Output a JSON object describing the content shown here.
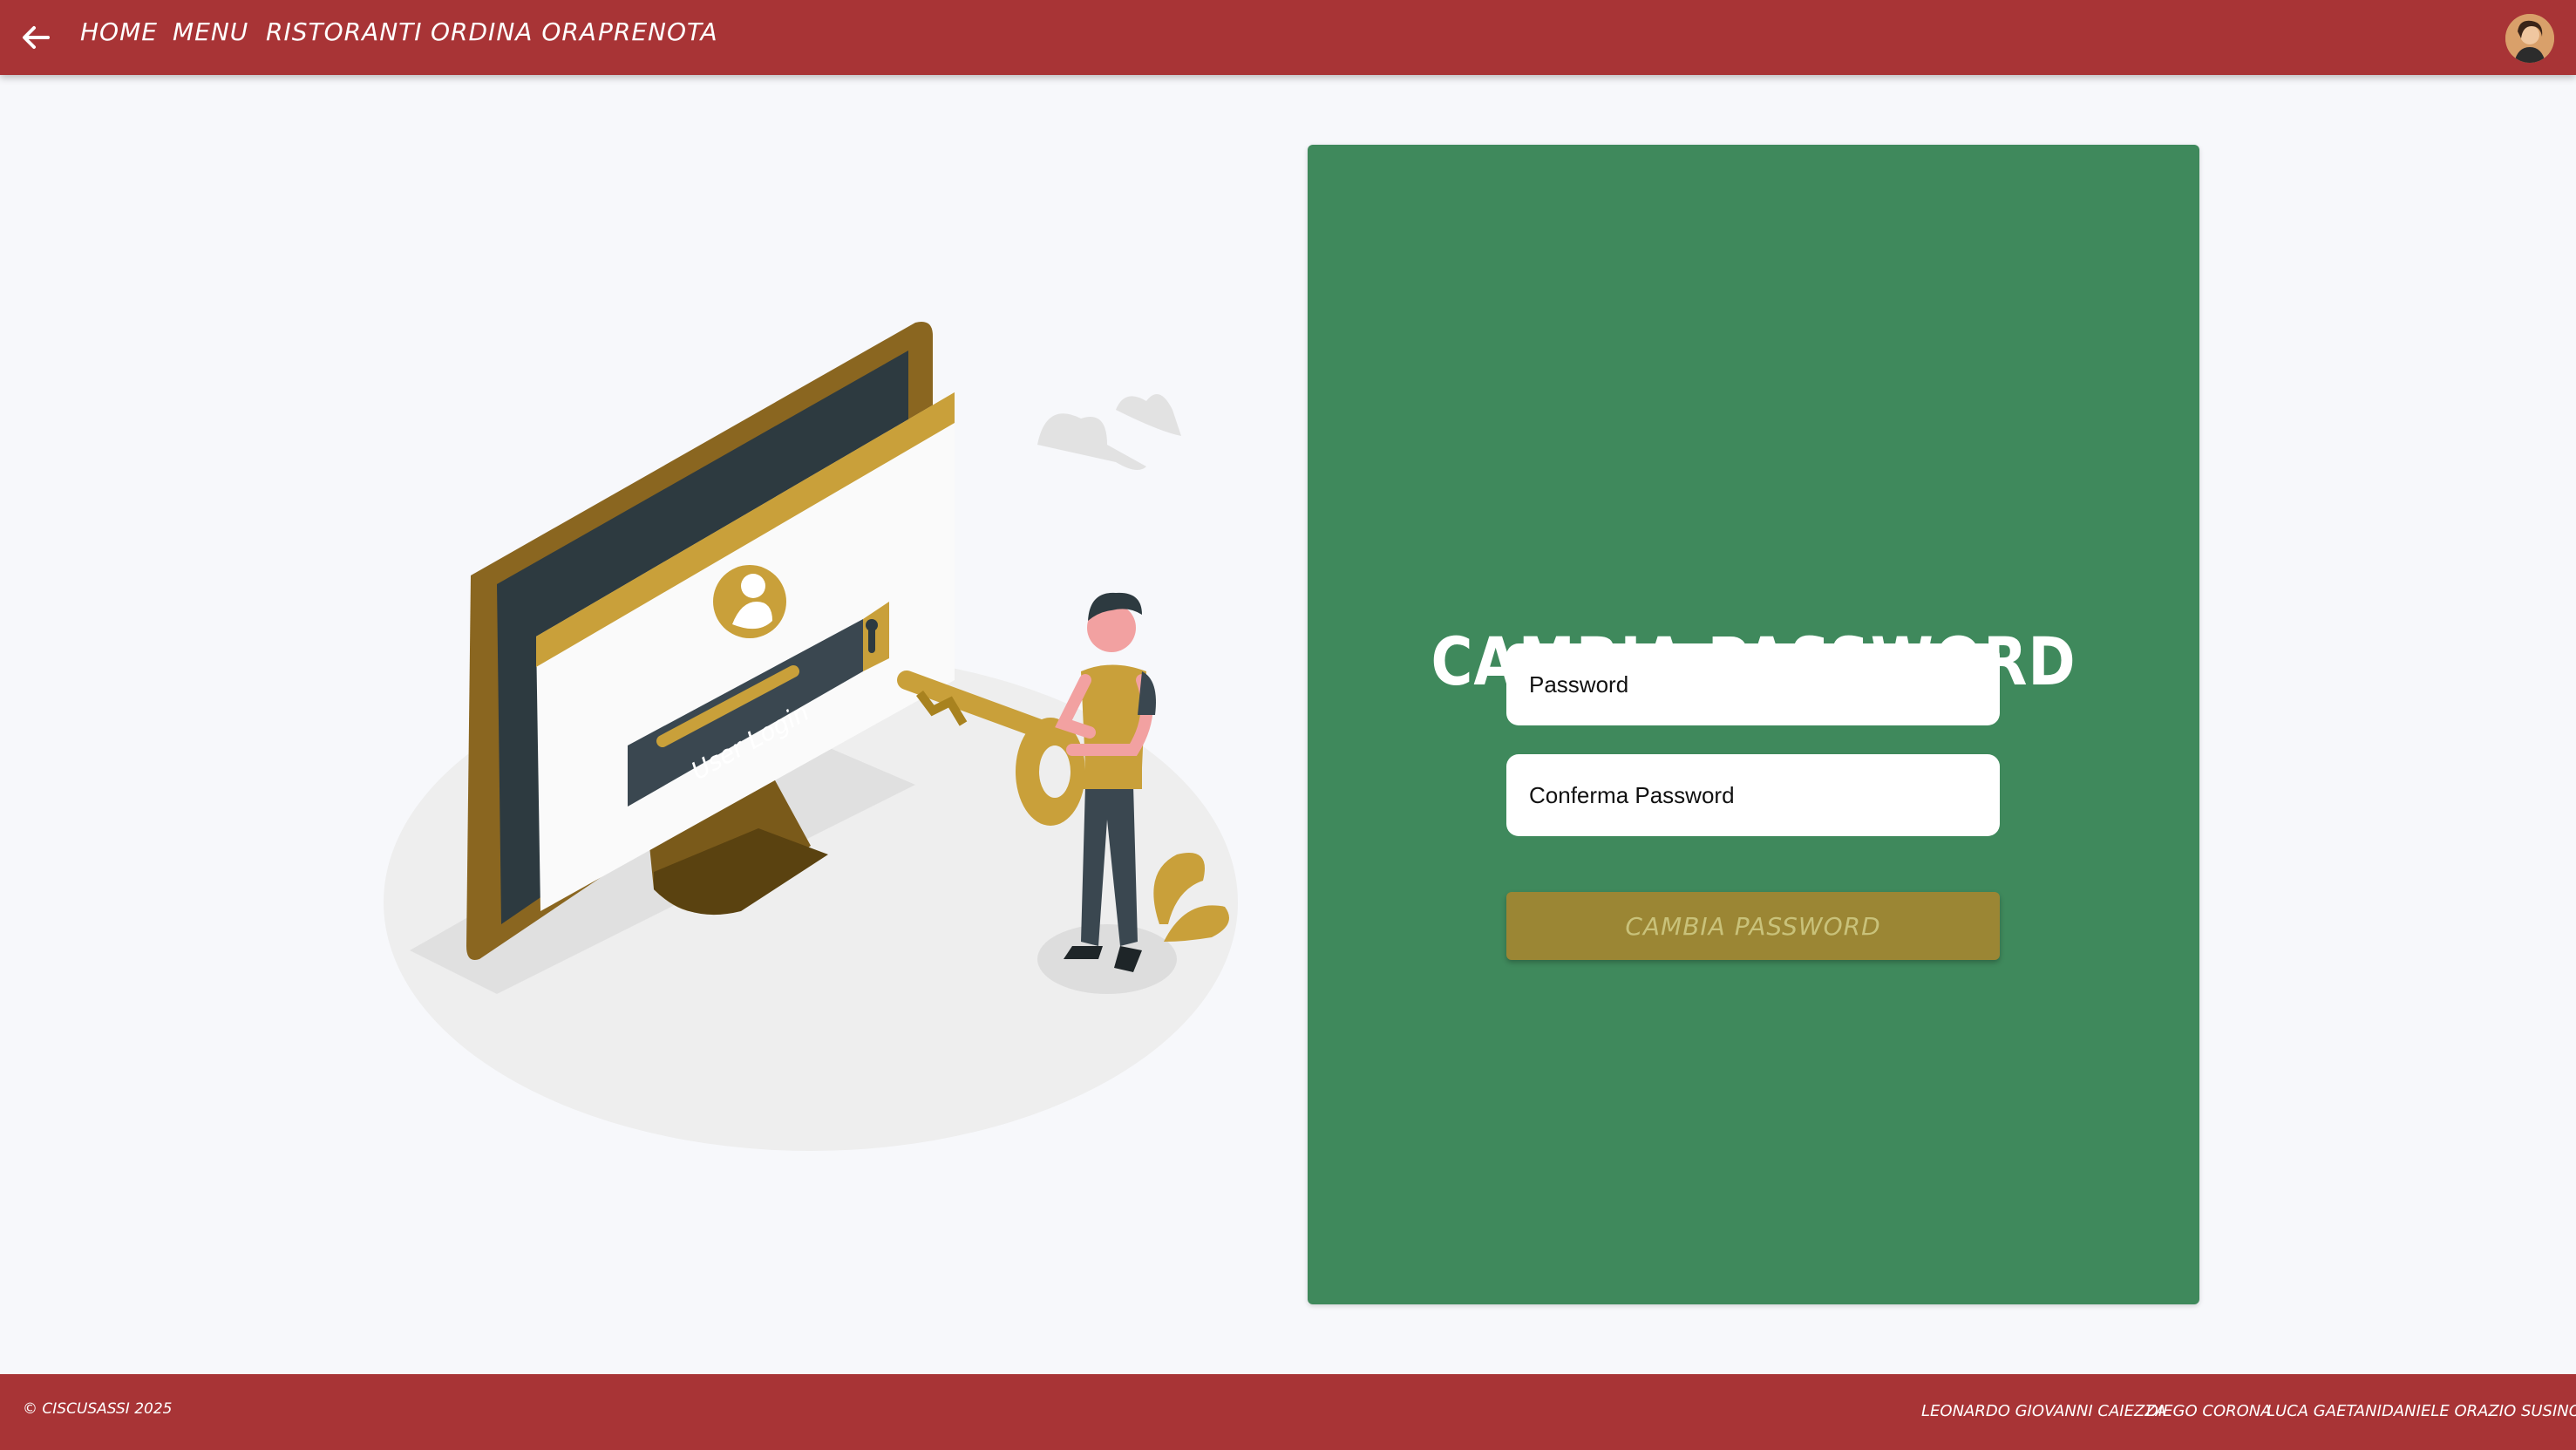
{
  "nav": {
    "back_icon": "arrow-left-icon",
    "links": [
      "HOME",
      "MENU",
      "RISTORANTI",
      "ORDINA ORA",
      "PRENOTA"
    ],
    "avatar_icon": "user-avatar"
  },
  "illustration": {
    "screen_text": "User Login"
  },
  "form": {
    "title": "CAMBIA PASSWORD",
    "password_placeholder": "Password",
    "confirm_placeholder": "Conferma Password",
    "submit_label": "CAMBIA PASSWORD"
  },
  "footer": {
    "copyright": "© CISCUSASSI 2025",
    "authors": [
      "LEONARDO GIOVANNI CAIEZZA",
      "DIEGO CORONA",
      "LUCA GAETANI",
      "DANIELE ORAZIO SUSINO"
    ]
  },
  "colors": {
    "header_red": "#a83436",
    "card_green": "#3f895c",
    "button_gold": "#9b8634",
    "background": "#f7f8fb"
  }
}
